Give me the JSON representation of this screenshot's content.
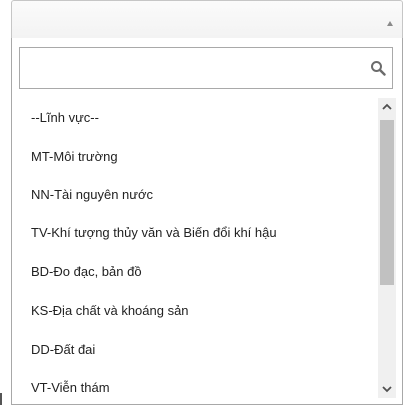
{
  "search": {
    "placeholder": "",
    "value": ""
  },
  "list": {
    "items": [
      {
        "label": "--Lĩnh vực--"
      },
      {
        "label": "MT-Môi trường"
      },
      {
        "label": "NN-Tài nguyên nước"
      },
      {
        "label": "TV-Khí tượng thủy văn và Biến đổi khí hậu"
      },
      {
        "label": "BD-Đo đạc, bản đồ"
      },
      {
        "label": "KS-Địa chất và khoáng sản"
      },
      {
        "label": "DD-Đất đai"
      },
      {
        "label": "VT-Viễn thám"
      }
    ]
  },
  "colors": {
    "border": "#a8a8a8",
    "scroll_thumb": "#c1c1c1",
    "scroll_track": "#f0f0f0"
  }
}
